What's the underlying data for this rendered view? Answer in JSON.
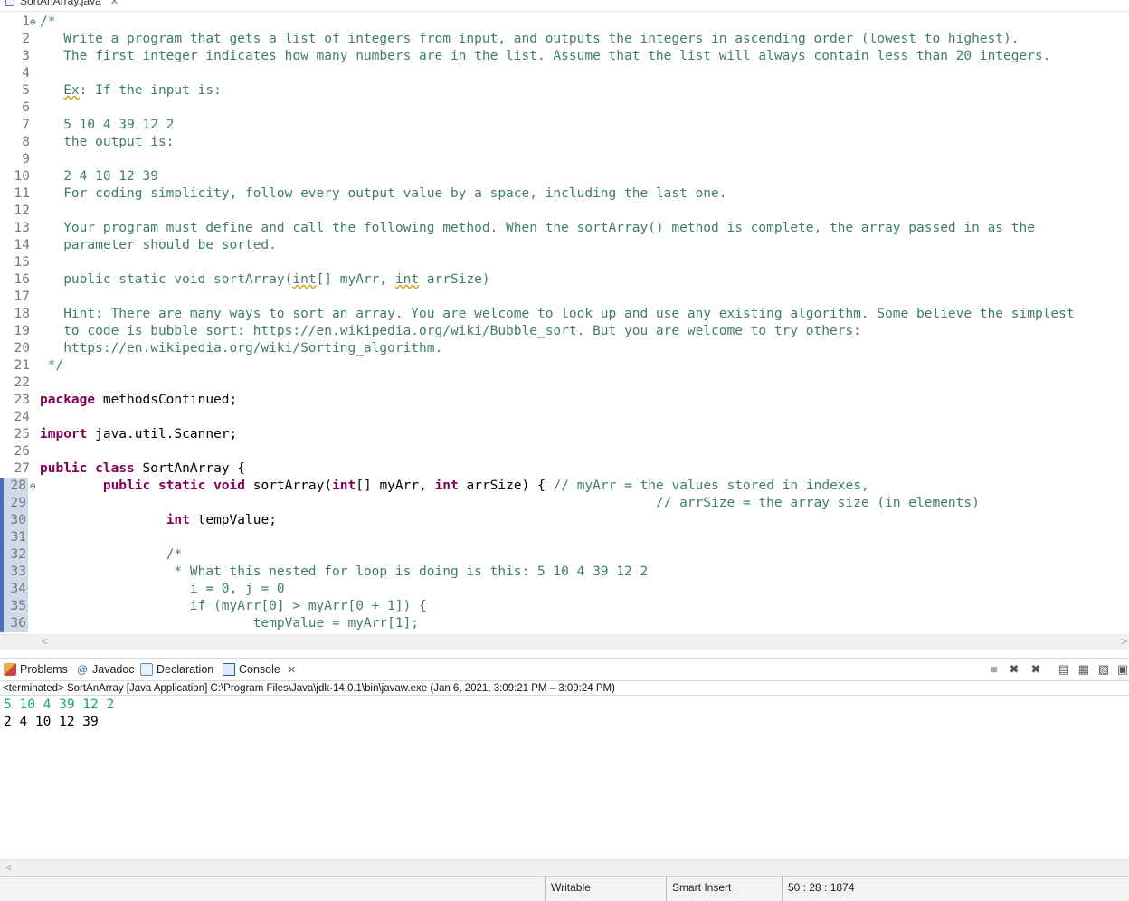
{
  "editor": {
    "tab_label": "SortAnArray.java",
    "lines": [
      {
        "n": "1",
        "fold": "⊖",
        "seg": [
          [
            "c",
            "/*"
          ]
        ]
      },
      {
        "n": "2",
        "seg": [
          [
            "c",
            "   Write a program that gets a list of integers from input, and outputs the integers in ascending order (lowest to highest). "
          ]
        ]
      },
      {
        "n": "3",
        "seg": [
          [
            "c",
            "   The first integer indicates how many numbers are in the list. Assume that the list will always contain less than 20 integers."
          ]
        ]
      },
      {
        "n": "4",
        "seg": []
      },
      {
        "n": "5",
        "seg": [
          [
            "c",
            "   "
          ],
          [
            "csq",
            "Ex"
          ],
          [
            "c",
            ": If the input is:"
          ]
        ]
      },
      {
        "n": "6",
        "seg": []
      },
      {
        "n": "7",
        "seg": [
          [
            "c",
            "   5 10 4 39 12 2"
          ]
        ]
      },
      {
        "n": "8",
        "seg": [
          [
            "c",
            "   the output is:"
          ]
        ]
      },
      {
        "n": "9",
        "seg": []
      },
      {
        "n": "10",
        "seg": [
          [
            "c",
            "   2 4 10 12 39"
          ]
        ]
      },
      {
        "n": "11",
        "seg": [
          [
            "c",
            "   For coding simplicity, follow every output value by a space, including the last one."
          ]
        ]
      },
      {
        "n": "12",
        "seg": []
      },
      {
        "n": "13",
        "seg": [
          [
            "c",
            "   Your program must define and call the following method. When the sortArray() method is complete, the array passed in as the"
          ]
        ]
      },
      {
        "n": "14",
        "seg": [
          [
            "c",
            "   parameter should be sorted."
          ]
        ]
      },
      {
        "n": "15",
        "seg": []
      },
      {
        "n": "16",
        "seg": [
          [
            "c",
            "   public static void sortArray("
          ],
          [
            "csq",
            "int"
          ],
          [
            "c",
            "[] myArr, "
          ],
          [
            "csq",
            "int"
          ],
          [
            "c",
            " arrSize)"
          ]
        ]
      },
      {
        "n": "17",
        "seg": []
      },
      {
        "n": "18",
        "seg": [
          [
            "c",
            "   Hint: There are many ways to sort an array. You are welcome to look up and use any existing algorithm. Some believe the simplest"
          ]
        ]
      },
      {
        "n": "19",
        "seg": [
          [
            "c",
            "   to code is bubble sort: https://en.wikipedia.org/wiki/Bubble_sort. But you are welcome to try others:"
          ]
        ]
      },
      {
        "n": "20",
        "seg": [
          [
            "c",
            "   https://en.wikipedia.org/wiki/Sorting_algorithm."
          ]
        ]
      },
      {
        "n": "21",
        "seg": [
          [
            "c",
            " */"
          ]
        ]
      },
      {
        "n": "22",
        "seg": []
      },
      {
        "n": "23",
        "seg": [
          [
            "kw",
            "package"
          ],
          [
            "tx",
            " methodsContinued;"
          ]
        ]
      },
      {
        "n": "24",
        "seg": []
      },
      {
        "n": "25",
        "seg": [
          [
            "kw",
            "import"
          ],
          [
            "tx",
            " java.util.Scanner;"
          ]
        ]
      },
      {
        "n": "26",
        "seg": []
      },
      {
        "n": "27",
        "seg": [
          [
            "kw",
            "public"
          ],
          [
            "tx",
            " "
          ],
          [
            "kw",
            "class"
          ],
          [
            "tx",
            " SortAnArray {"
          ]
        ]
      },
      {
        "n": "28",
        "fold": "⊖",
        "blue": true,
        "seg": [
          [
            "tx",
            "        "
          ],
          [
            "kw",
            "public"
          ],
          [
            "tx",
            " "
          ],
          [
            "kw",
            "static"
          ],
          [
            "tx",
            " "
          ],
          [
            "kw",
            "void"
          ],
          [
            "tx",
            " sortArray("
          ],
          [
            "kw",
            "int"
          ],
          [
            "tx",
            "[] myArr, "
          ],
          [
            "kw",
            "int"
          ],
          [
            "tx",
            " arrSize) { "
          ],
          [
            "c",
            "// myArr = the values stored in indexes,"
          ]
        ]
      },
      {
        "n": "29",
        "blue": true,
        "seg": [
          [
            "tx",
            "                                                                              "
          ],
          [
            "c",
            "// arrSize = the array size (in elements)"
          ]
        ]
      },
      {
        "n": "30",
        "blue": true,
        "seg": [
          [
            "tx",
            "                "
          ],
          [
            "kw",
            "int"
          ],
          [
            "tx",
            " tempValue;"
          ]
        ]
      },
      {
        "n": "31",
        "blue": true,
        "seg": []
      },
      {
        "n": "32",
        "blue": true,
        "seg": [
          [
            "tx",
            "                "
          ],
          [
            "c",
            "/*"
          ]
        ]
      },
      {
        "n": "33",
        "blue": true,
        "seg": [
          [
            "tx",
            "                 "
          ],
          [
            "c",
            "* What this nested for loop is doing is this: 5 10 4 39 12 2"
          ]
        ]
      },
      {
        "n": "34",
        "blue": true,
        "seg": [
          [
            "tx",
            "                   "
          ],
          [
            "c",
            "i = 0, j = 0"
          ]
        ]
      },
      {
        "n": "35",
        "blue": true,
        "seg": [
          [
            "tx",
            "                   "
          ],
          [
            "c",
            "if (myArr[0] > myArr[0 + 1]) {"
          ]
        ]
      },
      {
        "n": "36",
        "blue": true,
        "seg": [
          [
            "tx",
            "                           "
          ],
          [
            "c",
            "tempValue = myArr[1];"
          ]
        ]
      }
    ]
  },
  "views": {
    "tabs": [
      {
        "label": "Problems",
        "icon": "problems-icon"
      },
      {
        "label": "Javadoc",
        "icon": "javadoc-icon"
      },
      {
        "label": "Declaration",
        "icon": "declaration-icon"
      },
      {
        "label": "Console",
        "icon": "console-icon",
        "active": true
      }
    ],
    "javadoc_glyph": "@",
    "close_glyph": "✕"
  },
  "console": {
    "description": "<terminated> SortAnArray [Java Application] C:\\Program Files\\Java\\jdk-14.0.1\\bin\\javaw.exe  (Jan 6, 2021, 3:09:21 PM – 3:09:24 PM)",
    "input_line": "5 10 4 39 12 2",
    "output_line": "2 4 10 12 39"
  },
  "status": {
    "writable": "Writable",
    "insert_mode": "Smart Insert",
    "position": "50 : 28 : 1874"
  },
  "colors": {
    "comment": "#3f7f5f",
    "keyword": "#7f0055",
    "console_input": "#1aa57a"
  }
}
